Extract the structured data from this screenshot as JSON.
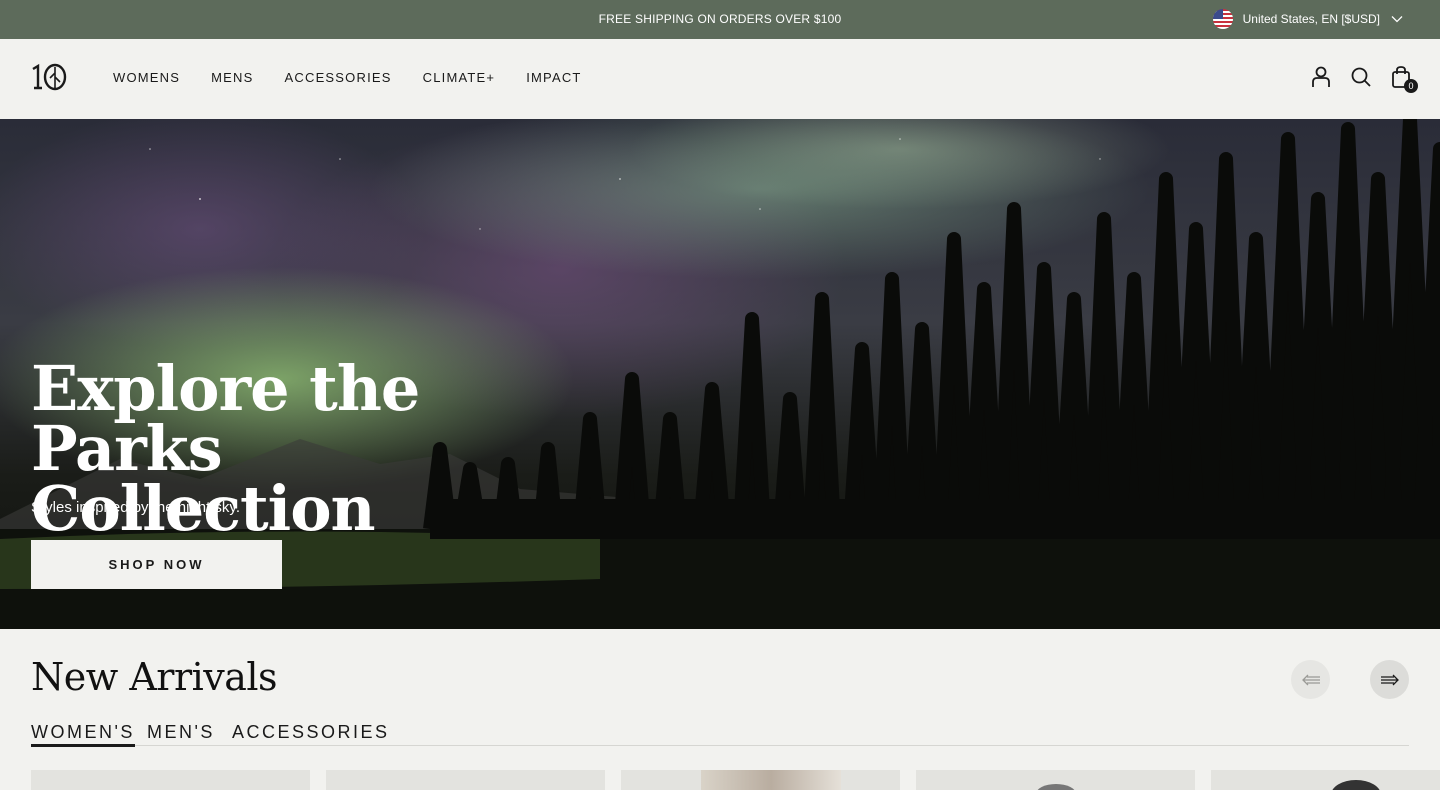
{
  "announcement": {
    "text": "FREE SHIPPING ON ORDERS OVER $100",
    "locale": "United States, EN [$USD]",
    "flag_icon": "us-flag-icon"
  },
  "header": {
    "logo_text": "10",
    "nav": [
      {
        "label": "WOMENS"
      },
      {
        "label": "MENS"
      },
      {
        "label": "ACCESSORIES"
      },
      {
        "label": "CLIMATE+"
      },
      {
        "label": "IMPACT"
      }
    ],
    "icons": [
      "account-icon",
      "search-icon",
      "bag-icon"
    ],
    "cart_count": "0"
  },
  "hero": {
    "title_line1": "Explore the Parks",
    "title_line2": "Collection",
    "subtitle": "Styles inspired by the night sky.",
    "cta": "SHOP NOW"
  },
  "new_arrivals": {
    "title": "New Arrivals",
    "tabs": [
      {
        "label": "WOMEN'S",
        "active": true
      },
      {
        "label": "MEN'S",
        "active": false
      },
      {
        "label": "ACCESSORIES",
        "active": false
      }
    ]
  },
  "colors": {
    "announcement_bg": "#5d6b5b",
    "page_bg": "#f2f2ef",
    "text": "#1a1a1a"
  }
}
